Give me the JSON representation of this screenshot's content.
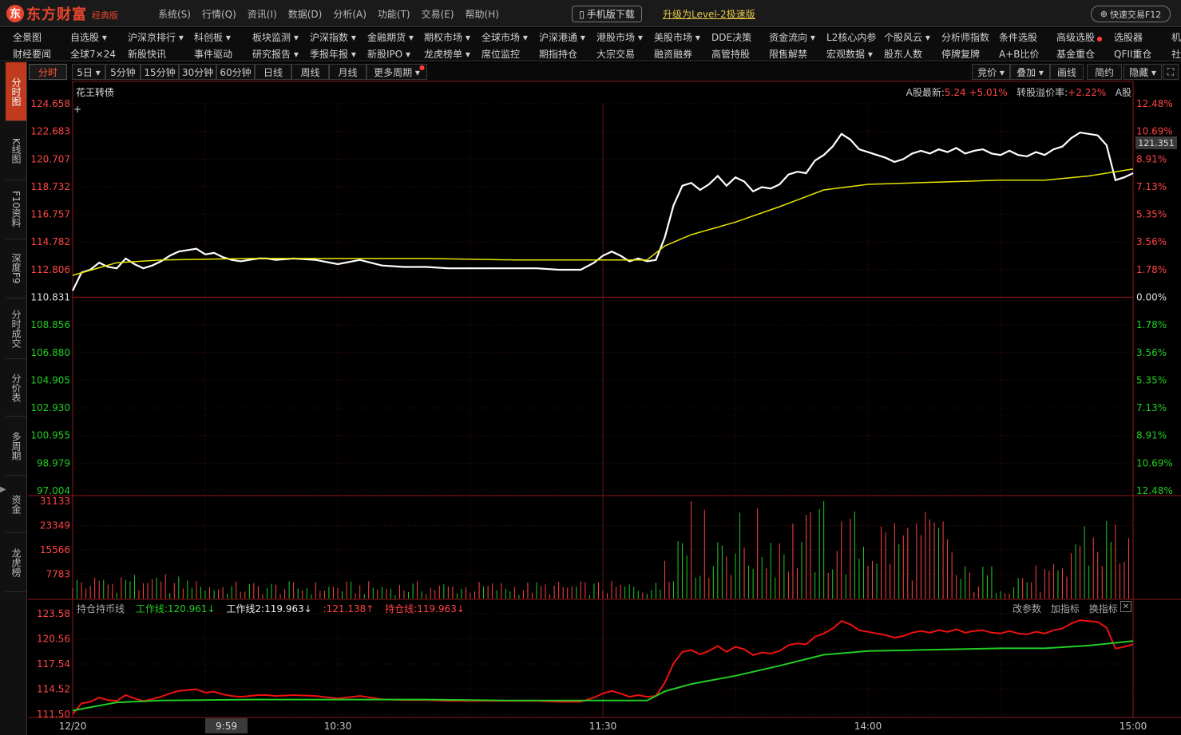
{
  "app": {
    "logo_mark": "东",
    "name": "东方财富",
    "edition": "经典版",
    "menu": [
      "系统(S)",
      "行情(Q)",
      "资讯(I)",
      "数据(D)",
      "分析(A)",
      "功能(T)",
      "交易(E)",
      "帮助(H)"
    ],
    "mobile_download": "手机版下载",
    "upgrade_link": "升级为Level-2极速版",
    "quick_trade": "快速交易F12"
  },
  "nav": {
    "row1": [
      "全景图",
      "自选股 ▾",
      "沪深京排行 ▾",
      "科创板 ▾",
      "板块监测 ▾",
      "沪深指数 ▾",
      "金融期货 ▾",
      "期权市场 ▾",
      "全球市场 ▾",
      "沪深港通 ▾",
      "港股市场 ▾",
      "美股市场 ▾",
      "DDE决策",
      "资金流向 ▾",
      "L2核心内参",
      "个股风云 ▾",
      "分析师指数",
      "条件选股",
      "高级选股",
      "选股器",
      "机"
    ],
    "row2": [
      "财经要闻",
      "全球7×24",
      "新股快讯",
      "事件驱动",
      "研究报告 ▾",
      "季报年报 ▾",
      "新股IPO ▾",
      "龙虎榜单 ▾",
      "席位监控",
      "期指持仓",
      "大宗交易",
      "融资融券",
      "高管持股",
      "限售解禁",
      "宏观数据 ▾",
      "股东人数",
      "停牌复牌",
      "A+B比价",
      "基金重仓",
      "QFII重仓",
      "社"
    ]
  },
  "left_tabs": [
    "分时图",
    "K线图",
    "F10资料",
    "深度F9",
    "分时成交",
    "分价表",
    "多周期",
    "资金",
    "龙虎榜"
  ],
  "period_bar": {
    "buttons": [
      "分时",
      "5日 ▾",
      "5分钟",
      "15分钟",
      "30分钟",
      "60分钟",
      "日线",
      "周线",
      "月线",
      "更多周期 ▾"
    ],
    "right_buttons": [
      "竞价 ▾",
      "叠加 ▾",
      "画线",
      "简约",
      "隐藏 ▾",
      "⛶"
    ]
  },
  "stock": {
    "name": "花王转债",
    "a_share_latest_label": "A股最新:",
    "a_share_latest_value": "5.24",
    "a_share_change": "+5.01%",
    "premium_label": "转股溢价率:",
    "premium_value": "+2.22%",
    "market_tag": "A股",
    "current_price": "121.351"
  },
  "price_axis": {
    "left": [
      "124.658",
      "122.683",
      "120.707",
      "118.732",
      "116.757",
      "114.782",
      "112.806",
      "110.831",
      "108.856",
      "106.880",
      "104.905",
      "102.930",
      "100.955",
      "98.979",
      "97.004"
    ],
    "right": [
      "12.48%",
      "10.69%",
      "8.91%",
      "7.13%",
      "5.35%",
      "3.56%",
      "1.78%",
      "0.00%",
      "1.78%",
      "3.56%",
      "5.35%",
      "7.13%",
      "8.91%",
      "10.69%",
      "12.48%"
    ]
  },
  "volume_axis": [
    "31133",
    "23349",
    "15566",
    "7783"
  ],
  "indicator": {
    "name": "持仓持币线",
    "work_line": "工作线:120.961↓",
    "work_line2": "工作线2:119.963↓",
    "value3": ":121.138↑",
    "hold_line": "持仓线:119.963↓",
    "tools": [
      "改参数",
      "加指标",
      "换指标"
    ],
    "axis": [
      "123.58",
      "120.56",
      "117.54",
      "114.52",
      "111.50"
    ]
  },
  "time_axis": {
    "labels": [
      "12/20",
      "10:30",
      "11:30",
      "14:00",
      "15:00"
    ],
    "cursor": "9:59"
  },
  "colors": {
    "up": "#ff4444",
    "down": "#22cc22",
    "price_line": "#ffffff",
    "avg_line": "#e6e600",
    "brand": "#e8452c"
  },
  "chart_data": {
    "type": "line",
    "title": "花王转债",
    "prev_close": 110.831,
    "ylim": [
      97.004,
      124.658
    ],
    "x_index_range": [
      0,
      240
    ],
    "series": [
      {
        "name": "price",
        "x": [
          0,
          2,
          4,
          6,
          8,
          10,
          12,
          14,
          16,
          18,
          20,
          22,
          24,
          26,
          28,
          30,
          32,
          34,
          36,
          38,
          40,
          42,
          44,
          46,
          50,
          55,
          60,
          65,
          70,
          75,
          80,
          85,
          90,
          95,
          100,
          105,
          110,
          115,
          118,
          120,
          122,
          124,
          126,
          128,
          130,
          132,
          134,
          136,
          138,
          140,
          142,
          144,
          146,
          148,
          150,
          152,
          154,
          156,
          158,
          160,
          162,
          164,
          166,
          168,
          170,
          172,
          174,
          176,
          178,
          180,
          182,
          184,
          186,
          188,
          190,
          192,
          194,
          196,
          198,
          200,
          202,
          204,
          206,
          208,
          210,
          212,
          214,
          216,
          218,
          220,
          222,
          224,
          226,
          228,
          230,
          232,
          234,
          236,
          238,
          240
        ],
        "y": [
          111.3,
          112.6,
          112.8,
          113.3,
          113.0,
          112.9,
          113.6,
          113.2,
          112.9,
          113.1,
          113.4,
          113.8,
          114.1,
          114.2,
          114.3,
          113.9,
          114.0,
          113.7,
          113.5,
          113.4,
          113.5,
          113.6,
          113.6,
          113.5,
          113.6,
          113.5,
          113.2,
          113.5,
          113.1,
          113.0,
          113.0,
          112.9,
          112.9,
          112.9,
          112.9,
          112.9,
          112.8,
          112.8,
          113.3,
          113.8,
          114.1,
          113.8,
          113.4,
          113.6,
          113.4,
          113.5,
          115.1,
          117.4,
          118.8,
          119.0,
          118.5,
          118.9,
          119.5,
          118.8,
          119.4,
          119.1,
          118.4,
          118.7,
          118.6,
          118.9,
          119.6,
          119.8,
          119.7,
          120.6,
          121.0,
          121.6,
          122.5,
          122.1,
          121.4,
          121.2,
          121.0,
          120.8,
          120.5,
          120.7,
          121.1,
          121.3,
          121.1,
          121.4,
          121.2,
          121.5,
          121.1,
          121.3,
          121.4,
          121.1,
          121.0,
          121.3,
          121.0,
          120.9,
          121.2,
          121.0,
          121.4,
          121.6,
          122.2,
          122.6,
          122.5,
          122.4,
          121.7,
          119.2,
          119.4,
          119.7
        ],
        "color": "#ffffff"
      },
      {
        "name": "avg",
        "x": [
          0,
          10,
          20,
          40,
          60,
          80,
          100,
          120,
          130,
          134,
          140,
          150,
          160,
          170,
          175,
          180,
          190,
          200,
          210,
          220,
          230,
          240
        ],
        "y": [
          112.4,
          113.3,
          113.5,
          113.6,
          113.6,
          113.6,
          113.5,
          113.5,
          113.5,
          114.5,
          115.3,
          116.2,
          117.3,
          118.5,
          118.7,
          118.9,
          119.0,
          119.1,
          119.2,
          119.2,
          119.5,
          120.0
        ],
        "color": "#e6e600"
      }
    ]
  }
}
